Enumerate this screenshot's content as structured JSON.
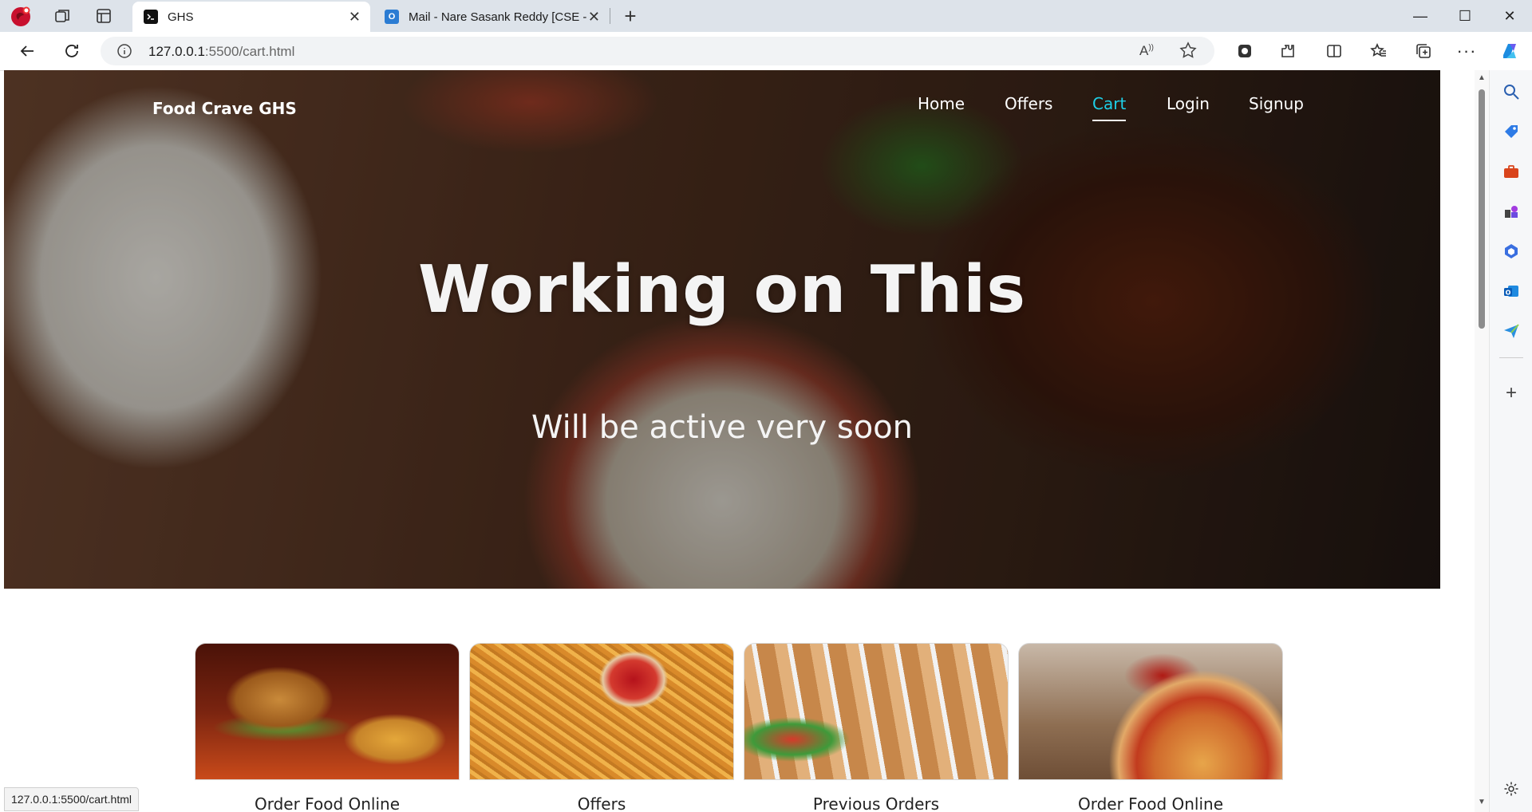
{
  "browser": {
    "tabs": [
      {
        "title": "GHS",
        "active": true
      },
      {
        "title": "Mail - Nare Sasank Reddy [CSE -",
        "active": false
      }
    ],
    "new_tab_symbol": "+",
    "close_symbol": "✕",
    "window_controls": {
      "minimize": "—",
      "maximize": "☐",
      "close": "✕"
    },
    "address": {
      "host": "127.0.0.1",
      "path": ":5500/cart.html"
    },
    "status_url": "127.0.0.1:5500/cart.html"
  },
  "site": {
    "brand": "Food Crave GHS",
    "nav": [
      {
        "label": "Home",
        "active": false
      },
      {
        "label": "Offers",
        "active": false
      },
      {
        "label": "Cart",
        "active": true
      },
      {
        "label": "Login",
        "active": false
      },
      {
        "label": "Signup",
        "active": false
      }
    ],
    "hero": {
      "title": "Working on This",
      "subtitle": "Will be active very soon"
    },
    "cards": [
      {
        "label": "Order Food Online",
        "image": "burger-and-fries"
      },
      {
        "label": "Offers",
        "image": "french-fries-with-ketchup"
      },
      {
        "label": "Previous Orders",
        "image": "chicken-kebab-skewers"
      },
      {
        "label": "Order Food Online",
        "image": "pizza"
      }
    ]
  },
  "colors": {
    "nav_active": "#1ed0e8",
    "tabstrip_bg": "#dde3ea",
    "hero_text": "#f4f4f4"
  }
}
